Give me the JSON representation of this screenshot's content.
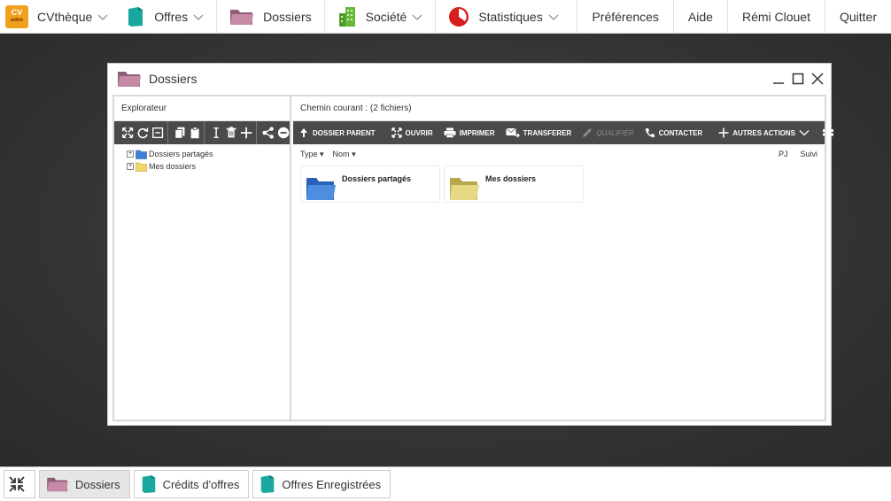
{
  "topnav": {
    "logo": {
      "line1": "CV",
      "line2": "aden"
    },
    "items": [
      {
        "label": "CVthèque",
        "icon": "cvtheque-logo-icon"
      },
      {
        "label": "Offres",
        "icon": "document-icon"
      },
      {
        "label": "Dossiers",
        "icon": "folder-icon"
      },
      {
        "label": "Société",
        "icon": "building-icon"
      },
      {
        "label": "Statistiques",
        "icon": "pie-chart-icon"
      }
    ],
    "right": [
      "Préférences",
      "Aide",
      "Rémi Clouet",
      "Quitter"
    ]
  },
  "window": {
    "title": "Dossiers",
    "explorer": {
      "header": "Explorateur",
      "tree": [
        "Dossiers partagés",
        "Mes dossiers"
      ]
    },
    "main": {
      "path": "Chemin courant : (2 fichiers)",
      "toolbar": {
        "parent": "DOSSIER PARENT",
        "open": "OUVRIR",
        "print": "IMPRIMER",
        "transfer": "TRANSFERER",
        "qualify": "QUALIFIER",
        "contact": "CONTACTER",
        "more": "AUTRES ACTIONS"
      },
      "columns": {
        "type": "Type",
        "name": "Nom",
        "pj": "PJ",
        "suivi": "Suivi"
      },
      "items": [
        {
          "name": "Dossiers partagés",
          "color": "#3d7fd6"
        },
        {
          "name": "Mes dossiers",
          "color": "#e3d37a"
        }
      ]
    }
  },
  "taskbar": {
    "tasks": [
      "Dossiers",
      "Crédits d'offres",
      "Offres Enregistrées"
    ]
  },
  "colors": {
    "logo": "#f0a01c",
    "offres": "#1aa7a0",
    "dossiers": "#b07a92",
    "societe": "#66b83a",
    "stats": "#d91c1c",
    "toolbar": "#4a4a4a"
  }
}
